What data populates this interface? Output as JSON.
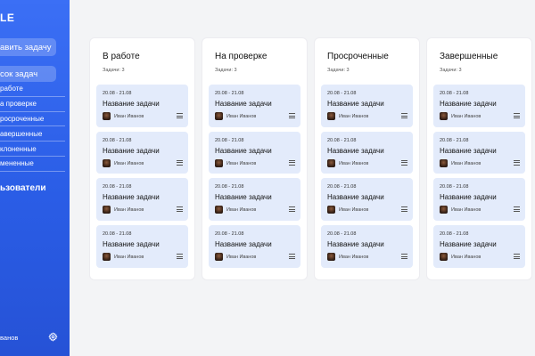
{
  "sidebar": {
    "logo": "LE",
    "add_button": "авить задачу",
    "list_button": "сок задач",
    "items": [
      {
        "label": "работе"
      },
      {
        "label": "а проверке"
      },
      {
        "label": "росроченные"
      },
      {
        "label": "авершенные"
      },
      {
        "label": "клоненные"
      },
      {
        "label": "мененные"
      }
    ],
    "users_label": "ьзователи",
    "user_name": "ванов",
    "settings_icon": "gear-icon"
  },
  "columns": [
    {
      "title": "В работе",
      "count": "Задачи: 3",
      "cards": [
        {
          "date": "20.08 - 21.08",
          "title": "Название задачи",
          "user": "Иван Иванов"
        },
        {
          "date": "20.08 - 21.08",
          "title": "Название задачи",
          "user": "Иван Иванов"
        },
        {
          "date": "20.08 - 21.08",
          "title": "Название задачи",
          "user": "Иван Иванов"
        },
        {
          "date": "20.08 - 21.08",
          "title": "Название задачи",
          "user": "Иван Иванов"
        }
      ]
    },
    {
      "title": "На проверке",
      "count": "Задачи: 3",
      "cards": [
        {
          "date": "20.08 - 21.08",
          "title": "Название задачи",
          "user": "Иван Иванов"
        },
        {
          "date": "20.08 - 21.08",
          "title": "Название задачи",
          "user": "Иван Иванов"
        },
        {
          "date": "20.08 - 21.08",
          "title": "Название задачи",
          "user": "Иван Иванов"
        },
        {
          "date": "20.08 - 21.08",
          "title": "Название задачи",
          "user": "Иван Иванов"
        }
      ]
    },
    {
      "title": "Просроченные",
      "count": "Задачи: 3",
      "cards": [
        {
          "date": "20.08 - 21.08",
          "title": "Название задачи",
          "user": "Иван Иванов"
        },
        {
          "date": "20.08 - 21.08",
          "title": "Название задачи",
          "user": "Иван Иванов"
        },
        {
          "date": "20.08 - 21.08",
          "title": "Название задачи",
          "user": "Иван Иванов"
        },
        {
          "date": "20.08 - 21.08",
          "title": "Название задачи",
          "user": "Иван Иванов"
        }
      ]
    },
    {
      "title": "Завершенные",
      "count": "Задачи: 3",
      "cards": [
        {
          "date": "20.08 - 21.08",
          "title": "Название задачи",
          "user": "Иван Иванов"
        },
        {
          "date": "20.08 - 21.08",
          "title": "Название задачи",
          "user": "Иван Иванов"
        },
        {
          "date": "20.08 - 21.08",
          "title": "Название задачи",
          "user": "Иван Иванов"
        },
        {
          "date": "20.08 - 21.08",
          "title": "Название задачи",
          "user": "Иван Иванов"
        }
      ]
    }
  ]
}
